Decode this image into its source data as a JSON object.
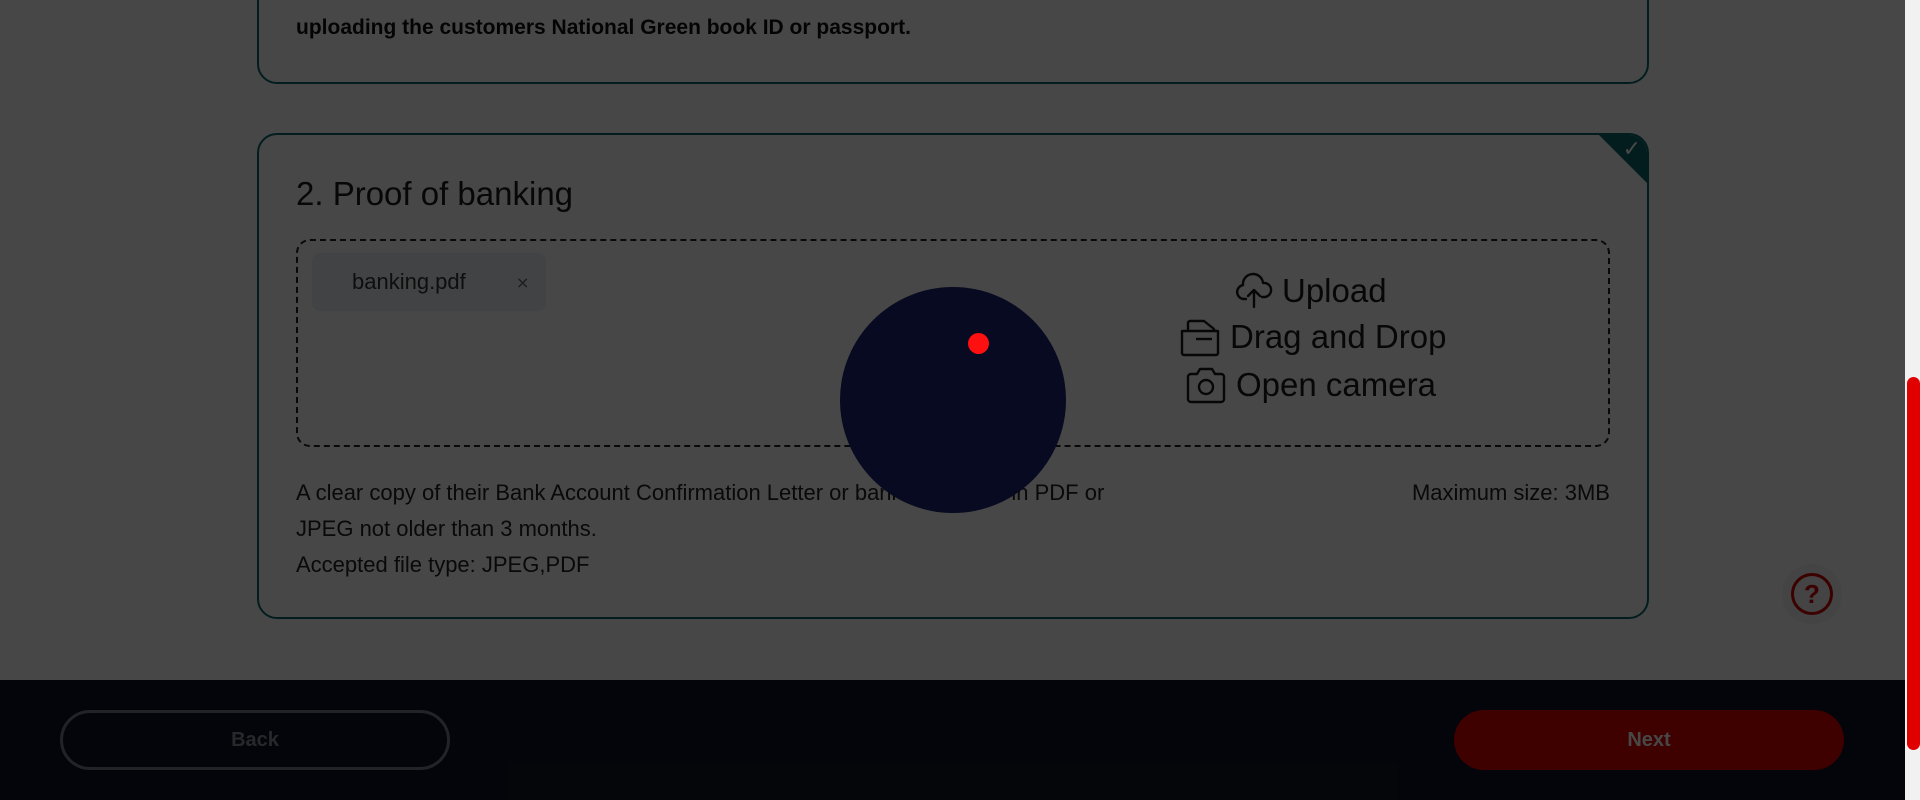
{
  "previous_card": {
    "text": "uploading the customers National Green book ID or passport."
  },
  "proof_of_banking": {
    "title": "2. Proof of banking",
    "completed_icon": "check-icon",
    "uploaded_file": {
      "name": "banking.pdf",
      "remove_label": "×"
    },
    "actions": {
      "upload": "Upload",
      "drag_drop": "Drag and Drop",
      "camera": "Open camera"
    },
    "description_line1": "A clear copy of their Bank Account Confirmation Letter or bank statement in PDF or",
    "description_line2": "JPEG not older than 3 months.",
    "accepted_types": "Accepted file type: JPEG,PDF",
    "max_size": "Maximum size: 3MB"
  },
  "help": {
    "label": "?"
  },
  "footer": {
    "back_label": "Back",
    "next_label": "Next"
  },
  "colors": {
    "accent": "#e00000",
    "card_border": "#0b6a6e",
    "footer_bg": "#0e1424"
  }
}
